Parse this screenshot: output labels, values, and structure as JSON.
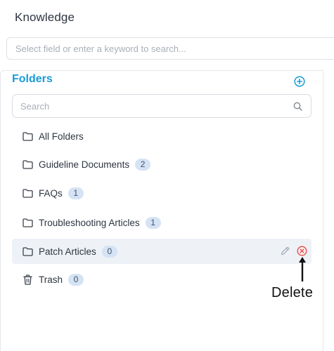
{
  "header": {
    "title": "Knowledge"
  },
  "global_search": {
    "placeholder": "Select field or enter a keyword to search..."
  },
  "folders_panel": {
    "title": "Folders",
    "search_placeholder": "Search",
    "items": [
      {
        "label": "All Folders",
        "icon": "folder-icon"
      },
      {
        "label": "Guideline Documents",
        "count": "2",
        "icon": "folder-icon"
      },
      {
        "label": "FAQs",
        "count": "1",
        "icon": "folder-icon"
      },
      {
        "label": "Troubleshooting Articles",
        "count": "1",
        "icon": "folder-icon"
      },
      {
        "label": "Patch Articles",
        "count": "0",
        "icon": "folder-icon",
        "selected": true
      },
      {
        "label": "Trash",
        "count": "0",
        "icon": "trash-icon"
      }
    ]
  },
  "annotation": {
    "label": "Delete"
  },
  "colors": {
    "accent": "#1a9bd7",
    "badge_bg": "#d5e3f4",
    "selected_row_bg": "#eef1f6",
    "delete_red": "#e04848"
  }
}
